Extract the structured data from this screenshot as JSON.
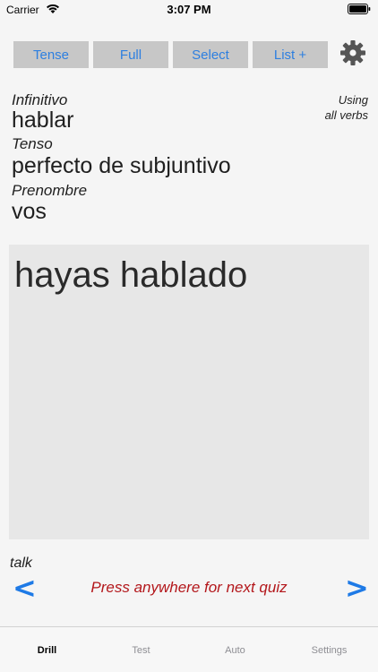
{
  "status": {
    "carrier": "Carrier",
    "time": "3:07 PM"
  },
  "toolbar": {
    "buttons": [
      {
        "label": "Tense"
      },
      {
        "label": "Full"
      },
      {
        "label": "Select"
      },
      {
        "label": "List +"
      }
    ]
  },
  "info": {
    "infinitive_label": "Infinitivo",
    "infinitive_value": "hablar",
    "tense_label": "Tenso",
    "tense_value": "perfecto de subjuntivo",
    "pronoun_label": "Prenombre",
    "pronoun_value": "vos",
    "using_line1": "Using",
    "using_line2": "all verbs"
  },
  "answer": {
    "text": "hayas hablado"
  },
  "footer": {
    "translation": "talk",
    "prev": "<",
    "next": ">",
    "prompt": "Press anywhere for next quiz"
  },
  "tabs": [
    {
      "label": "Drill"
    },
    {
      "label": "Test"
    },
    {
      "label": "Auto"
    },
    {
      "label": "Settings"
    }
  ],
  "colors": {
    "accent": "#2d7fe0",
    "prompt": "#b3171b",
    "card": "#e7e7e7"
  }
}
